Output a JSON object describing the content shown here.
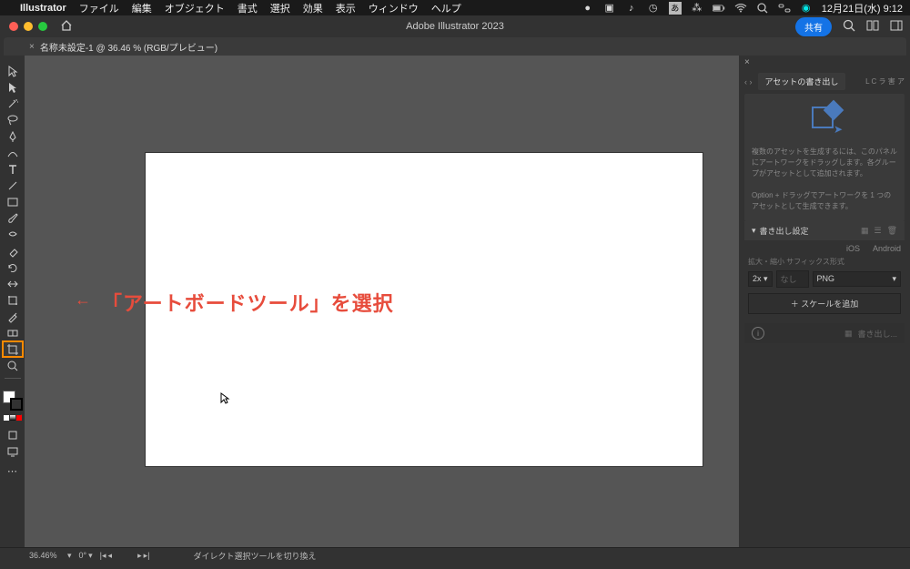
{
  "menubar": {
    "app": "Illustrator",
    "items": [
      "ファイル",
      "編集",
      "オブジェクト",
      "書式",
      "選択",
      "効果",
      "表示",
      "ウィンドウ",
      "ヘルプ"
    ],
    "datetime": "12月21日(水) 9:12"
  },
  "appbar": {
    "title": "Adobe Illustrator 2023",
    "share": "共有"
  },
  "tab": {
    "label": "名称未設定-1 @ 36.46 % (RGB/プレビュー)"
  },
  "annotation": {
    "arrow": "←",
    "text": "「アートボードツール」を選択"
  },
  "panel": {
    "tab_main": "アセットの書き出し",
    "tab_sub": "L C ラ 害 ア",
    "hint1": "複数のアセットを生成するには、このパネルにアートワークをドラッグします。各グループがアセットとして追加されます。",
    "hint2": "Option + ドラッグでアートワークを 1 つのアセットとして生成できます。",
    "settings_header": "書き出し設定",
    "plat_ios": "iOS",
    "plat_android": "Android",
    "scale_label": "拡大・縮小  サフィックス形式",
    "scale_val": "2x",
    "suffix_val": "なし",
    "format_val": "PNG",
    "add_scale": "＋ スケールを追加",
    "export_btn": "書き出し..."
  },
  "status": {
    "zoom": "36.46%",
    "rotation": "0°",
    "hint": "ダイレクト選択ツールを切り換え"
  }
}
